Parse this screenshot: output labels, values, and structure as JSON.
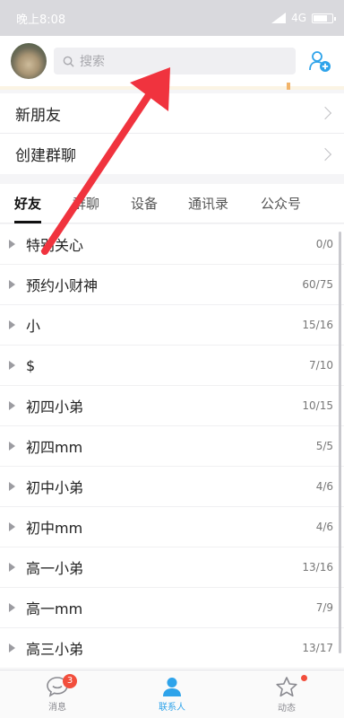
{
  "status_bar": {
    "time": "晚上8:08",
    "network": "4G"
  },
  "header": {
    "search_placeholder": "搜索"
  },
  "menu": [
    {
      "label": "新朋友"
    },
    {
      "label": "创建群聊"
    }
  ],
  "tabs": [
    {
      "label": "好友",
      "active": true
    },
    {
      "label": "群聊",
      "active": false
    },
    {
      "label": "设备",
      "active": false
    },
    {
      "label": "通讯录",
      "active": false
    },
    {
      "label": "公众号",
      "active": false
    }
  ],
  "groups": [
    {
      "name": "特别关心",
      "count": "0/0"
    },
    {
      "name": "预约小财神",
      "count": "60/75"
    },
    {
      "name": "小",
      "count": "15/16"
    },
    {
      "name": "$",
      "count": "7/10"
    },
    {
      "name": "初四小弟",
      "count": "10/15"
    },
    {
      "name": "初四mm",
      "count": "5/5"
    },
    {
      "name": "初中小弟",
      "count": "4/6"
    },
    {
      "name": "初中mm",
      "count": "4/6"
    },
    {
      "name": "高一小弟",
      "count": "13/16"
    },
    {
      "name": "高一mm",
      "count": "7/9"
    },
    {
      "name": "高三小弟",
      "count": "13/17"
    }
  ],
  "bottom_nav": [
    {
      "label": "消息",
      "badge": "3",
      "icon": "chat-bubble-icon"
    },
    {
      "label": "联系人",
      "icon": "person-icon",
      "active": true
    },
    {
      "label": "动态",
      "icon": "star-icon",
      "dot": true
    }
  ],
  "colors": {
    "accent": "#2ea3ea",
    "badge": "#f24e3c",
    "arrow": "#f0333e"
  }
}
